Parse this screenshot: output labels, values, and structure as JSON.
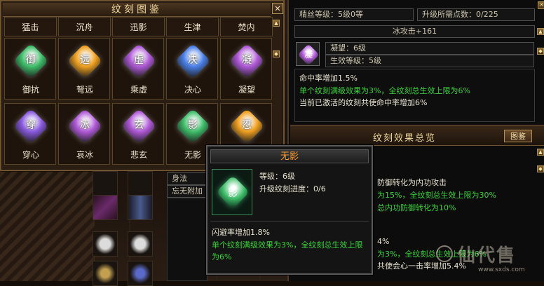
{
  "codex": {
    "title": "纹刻图鉴",
    "close_glyph": "✕",
    "top_row": [
      "猛击",
      "沉舟",
      "迅影",
      "生津",
      "焚内"
    ],
    "tiles_row1": [
      {
        "label": "御抗",
        "glyph": "御",
        "color": "#3fbf6a"
      },
      {
        "label": "弩远",
        "glyph": "远",
        "color": "#f0a020"
      },
      {
        "label": "乘虚",
        "glyph": "虚",
        "color": "#b05ad8"
      },
      {
        "label": "决心",
        "glyph": "决",
        "color": "#4a80e8"
      },
      {
        "label": "凝望",
        "glyph": "凝",
        "color": "#b05ad8"
      }
    ],
    "tiles_row2": [
      {
        "label": "穿心",
        "glyph": "穿",
        "color": "#8a5ae0"
      },
      {
        "label": "哀冰",
        "glyph": "冰",
        "color": "#b05ad8"
      },
      {
        "label": "悲玄",
        "glyph": "玄",
        "color": "#b05ad8"
      },
      {
        "label": "无影",
        "glyph": "影",
        "color": "#3fbf6a"
      },
      {
        "label": "",
        "glyph": "忍",
        "color": "#f0a020"
      }
    ]
  },
  "right": {
    "level_label": "精丝等级：5级0等",
    "points_label": "升级所需点数：0/225",
    "ice_attack": "冰攻击+161",
    "gem_glyph": "凝",
    "gem_color": "#b05ad8",
    "name_field": "凝望：6级",
    "effect_level": "生效等级：5级",
    "desc_line1": "命中率增加1.5%",
    "desc_line2": "单个纹刻满级效果为3%，全纹刻总生效上限为6%",
    "desc_line3": "当前已激活的纹刻共使命中率增加6%",
    "overview_title": "纹刻效果总览",
    "overview_button": "图鉴",
    "ov_line1": "防御转化为内功攻击",
    "ov_line2": "为15%，全纹刻总生效上限为30%",
    "ov_line3": "总内功防御转化为10%",
    "ov_line4": "4%",
    "ov_line5": "为3%，全纹刻总生效上限为6%",
    "ov_line6": "共使会心一击率增加5.4%"
  },
  "middle": {
    "field1": "身法",
    "field2": "忘无附加"
  },
  "tooltip": {
    "title": "无影",
    "gem_glyph": "影",
    "gem_color": "#3fbf6a",
    "level": "等级：6级",
    "progress": "升级纹刻进度：0/6",
    "line1": "闪避率增加1.8%",
    "line2": "单个纹刻满级效果为3%，全纹刻总生效上限为6%"
  },
  "watermark": {
    "brand": "仙代售",
    "url": "www.sxds.com"
  }
}
